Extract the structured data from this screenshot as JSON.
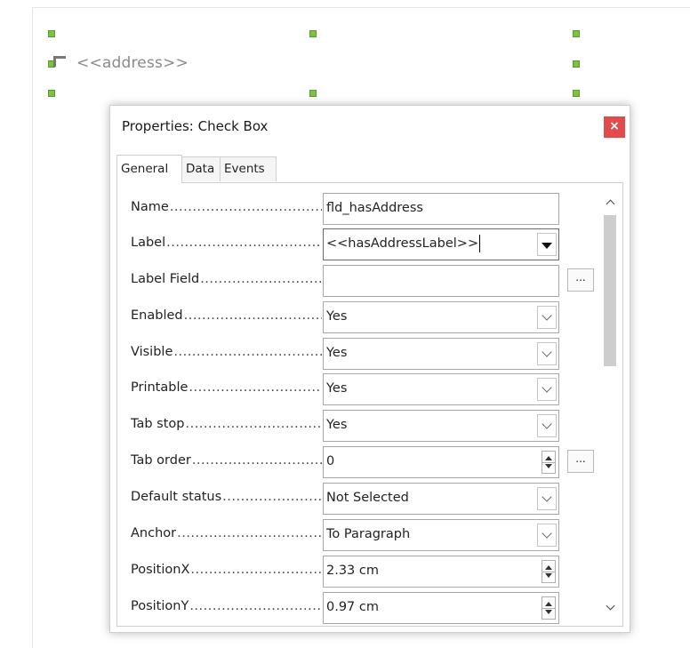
{
  "document": {
    "field_text": "<<address>>"
  },
  "dialog": {
    "title": "Properties: Check Box",
    "close_label": "×",
    "tabs": [
      {
        "label": "General"
      },
      {
        "label": "Data"
      },
      {
        "label": "Events"
      }
    ],
    "active_tab": "General",
    "properties": [
      {
        "label": "Name",
        "value": "fld_hasAddress",
        "control": "text"
      },
      {
        "label": "Label",
        "value": "<<hasAddressLabel>>",
        "control": "combo-focused"
      },
      {
        "label": "Label Field",
        "value": "",
        "control": "text-button"
      },
      {
        "label": "Enabled",
        "value": "Yes",
        "control": "dropdown"
      },
      {
        "label": "Visible",
        "value": "Yes",
        "control": "dropdown"
      },
      {
        "label": "Printable",
        "value": "Yes",
        "control": "dropdown"
      },
      {
        "label": "Tab stop",
        "value": "Yes",
        "control": "dropdown"
      },
      {
        "label": "Tab order",
        "value": "0",
        "control": "spin-button"
      },
      {
        "label": "Default status",
        "value": "Not Selected",
        "control": "dropdown"
      },
      {
        "label": "Anchor",
        "value": "To Paragraph",
        "control": "dropdown"
      },
      {
        "label": "PositionX",
        "value": "2.33 cm",
        "control": "spin"
      },
      {
        "label": "PositionY",
        "value": "0.97 cm",
        "control": "spin"
      }
    ],
    "ellipsis_label": "..."
  },
  "colors": {
    "handle": "#7fc241",
    "close": "#e34b4b"
  }
}
